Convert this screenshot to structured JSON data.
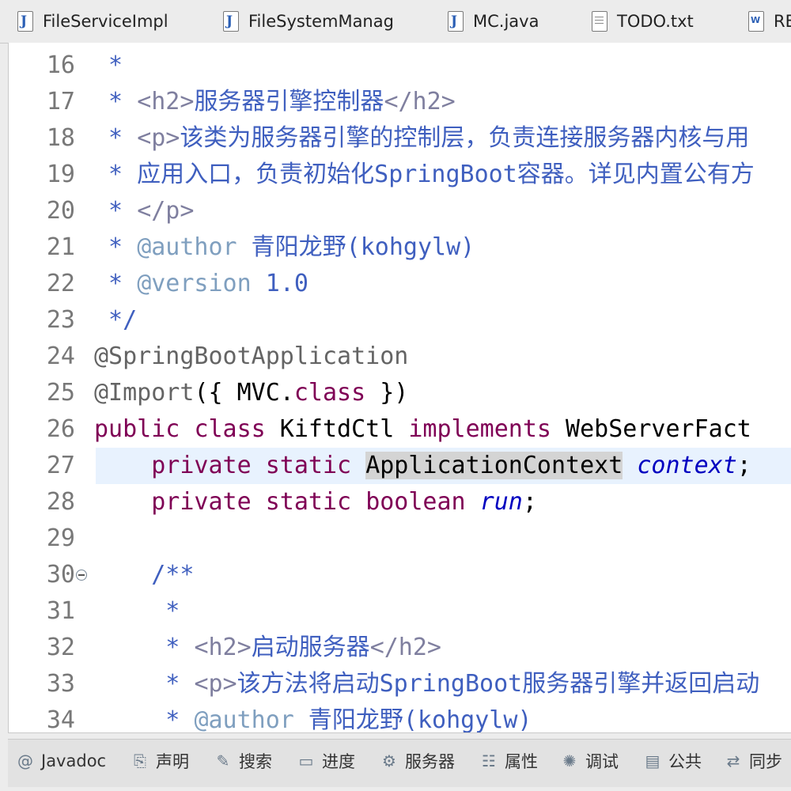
{
  "tabs": [
    {
      "label": "FileServiceImpl",
      "icon": "java-file-icon"
    },
    {
      "label": "FileSystemManag",
      "icon": "java-file-icon"
    },
    {
      "label": "MC.java",
      "icon": "java-file-icon"
    },
    {
      "label": "TODO.txt",
      "icon": "text-file-icon"
    },
    {
      "label": "RE",
      "icon": "word-file-icon"
    }
  ],
  "lines": [
    {
      "n": "16",
      "segs": [
        [
          "c",
          " *"
        ]
      ]
    },
    {
      "n": "17",
      "segs": [
        [
          "c",
          " * "
        ],
        [
          "t",
          "<h2>"
        ],
        [
          "c",
          "服务器引擎控制器"
        ],
        [
          "t",
          "</h2>"
        ]
      ]
    },
    {
      "n": "18",
      "segs": [
        [
          "c",
          " * "
        ],
        [
          "t",
          "<p>"
        ],
        [
          "c",
          "该类为服务器引擎的控制层，负责连接服务器内核与用"
        ]
      ]
    },
    {
      "n": "19",
      "segs": [
        [
          "c",
          " * 应用入口，负责初始化SpringBoot容器。详见内置公有方"
        ]
      ]
    },
    {
      "n": "20",
      "segs": [
        [
          "c",
          " * "
        ],
        [
          "t",
          "</p>"
        ]
      ]
    },
    {
      "n": "21",
      "segs": [
        [
          "c",
          " * "
        ],
        [
          "a",
          "@author"
        ],
        [
          "c",
          " 青阳龙野(kohgylw)"
        ]
      ]
    },
    {
      "n": "22",
      "segs": [
        [
          "c",
          " * "
        ],
        [
          "a",
          "@version"
        ],
        [
          "c",
          " 1.0"
        ]
      ]
    },
    {
      "n": "23",
      "segs": [
        [
          "c",
          " */"
        ]
      ]
    },
    {
      "n": "24",
      "segs": [
        [
          "an",
          "@SpringBootApplication"
        ]
      ]
    },
    {
      "n": "25",
      "segs": [
        [
          "an",
          "@Import"
        ],
        [
          "p",
          "({ MVC."
        ],
        [
          "k",
          "class"
        ],
        [
          "p",
          " })"
        ]
      ]
    },
    {
      "n": "26",
      "segs": [
        [
          "k",
          "public"
        ],
        [
          "p",
          " "
        ],
        [
          "k",
          "class"
        ],
        [
          "p",
          " KiftdCtl "
        ],
        [
          "k",
          "implements"
        ],
        [
          "p",
          " WebServerFact"
        ]
      ]
    },
    {
      "n": "27",
      "segs": [
        [
          "p",
          "    "
        ],
        [
          "k",
          "private"
        ],
        [
          "p",
          " "
        ],
        [
          "k",
          "static"
        ],
        [
          "p",
          " "
        ],
        [
          "sel",
          "ApplicationContext"
        ],
        [
          "p",
          " "
        ],
        [
          "f",
          "context"
        ],
        [
          "p",
          ";"
        ]
      ],
      "current": true
    },
    {
      "n": "28",
      "segs": [
        [
          "p",
          "    "
        ],
        [
          "k",
          "private"
        ],
        [
          "p",
          " "
        ],
        [
          "k",
          "static"
        ],
        [
          "p",
          " "
        ],
        [
          "k",
          "boolean"
        ],
        [
          "p",
          " "
        ],
        [
          "f",
          "run"
        ],
        [
          "p",
          ";"
        ]
      ]
    },
    {
      "n": "29",
      "segs": []
    },
    {
      "n": "30",
      "segs": [
        [
          "c",
          "    /**"
        ]
      ],
      "fold": true
    },
    {
      "n": "31",
      "segs": [
        [
          "c",
          "     *"
        ]
      ]
    },
    {
      "n": "32",
      "segs": [
        [
          "c",
          "     * "
        ],
        [
          "t",
          "<h2>"
        ],
        [
          "c",
          "启动服务器"
        ],
        [
          "t",
          "</h2>"
        ]
      ]
    },
    {
      "n": "33",
      "segs": [
        [
          "c",
          "     * "
        ],
        [
          "t",
          "<p>"
        ],
        [
          "c",
          "该方法将启动SpringBoot服务器引擎并返回启动"
        ]
      ]
    },
    {
      "n": "34",
      "segs": [
        [
          "c",
          "     * "
        ],
        [
          "a",
          "@author"
        ],
        [
          "c",
          " 青阳龙野(kohgylw)"
        ]
      ]
    }
  ],
  "bottom_tabs": [
    {
      "label": "Javadoc",
      "icon": "at-icon"
    },
    {
      "label": "声明",
      "icon": "declaration-icon"
    },
    {
      "label": "搜索",
      "icon": "search-flashlight-icon"
    },
    {
      "label": "进度",
      "icon": "progress-icon"
    },
    {
      "label": "服务器",
      "icon": "servers-icon"
    },
    {
      "label": "属性",
      "icon": "properties-icon"
    },
    {
      "label": "调试",
      "icon": "debug-bug-icon"
    },
    {
      "label": "公共",
      "icon": "clipboard-icon"
    },
    {
      "label": "同步",
      "icon": "synchronize-icon"
    }
  ]
}
